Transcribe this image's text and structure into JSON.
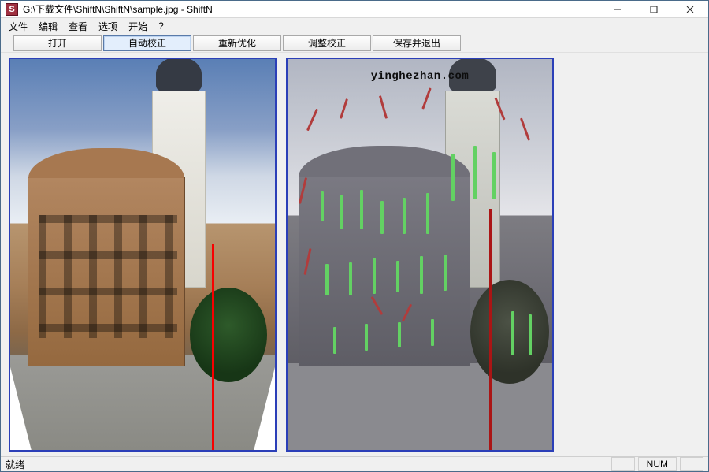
{
  "titlebar": {
    "icon_letter": "S",
    "title": "G:\\下载文件\\ShiftN\\ShiftN\\sample.jpg - ShiftN"
  },
  "menu": {
    "items": [
      "文件",
      "编辑",
      "查看",
      "选项",
      "开始",
      "?"
    ]
  },
  "toolbar": {
    "buttons": [
      {
        "id": "open",
        "label": "打开",
        "active": false
      },
      {
        "id": "auto",
        "label": "自动校正",
        "active": true
      },
      {
        "id": "reoptimize",
        "label": "重新优化",
        "active": false
      },
      {
        "id": "adjust",
        "label": "调整校正",
        "active": false
      },
      {
        "id": "save_exit",
        "label": "保存并退出",
        "active": false
      }
    ]
  },
  "watermark": "yinghezhan.com",
  "statusbar": {
    "ready": "就绪",
    "indicator": "NUM"
  }
}
